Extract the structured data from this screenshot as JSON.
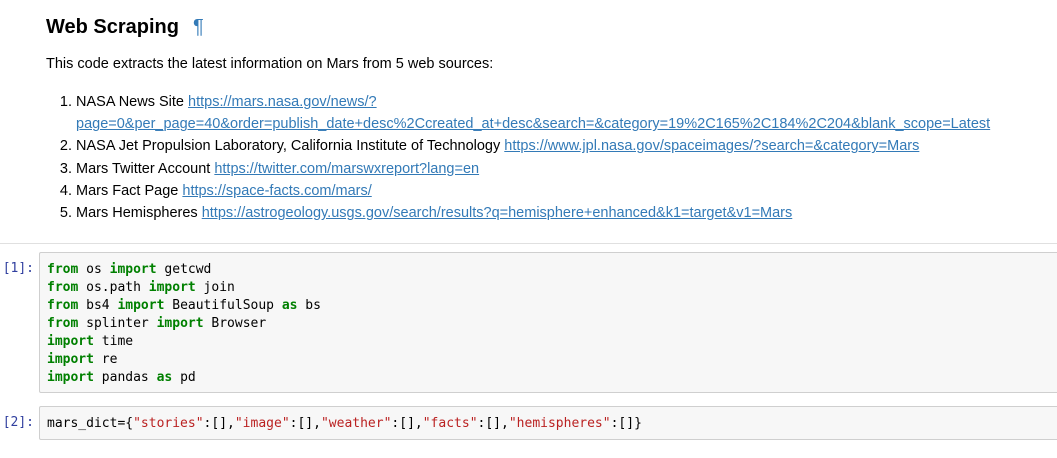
{
  "markdown": {
    "title": "Web Scraping",
    "anchor_symbol": "¶",
    "intro": "This code extracts the latest information on Mars from 5 web sources:",
    "sources": [
      {
        "label": "NASA News Site",
        "url": "https://mars.nasa.gov/news/?page=0&per_page=40&order=publish_date+desc%2Ccreated_at+desc&search=&category=19%2C165%2C184%2C204&blank_scope=Latest",
        "url_line1": "https://mars.nasa.gov/news/?",
        "url_line2": "page=0&per_page=40&order=publish_date+desc%2Ccreated_at+desc&search=&category=19%2C165%2C184%2C204&blank_scope=Latest"
      },
      {
        "label": "NASA Jet Propulsion Laboratory, California Institute of Technology",
        "url": "https://www.jpl.nasa.gov/spaceimages/?search=&category=Mars"
      },
      {
        "label": "Mars Twitter Account",
        "url": "https://twitter.com/marswxreport?lang=en"
      },
      {
        "label": "Mars Fact Page",
        "url": "https://space-facts.com/mars/"
      },
      {
        "label": "Mars Hemispheres",
        "url": "https://astrogeology.usgs.gov/search/results?q=hemisphere+enhanced&k1=target&v1=Mars"
      }
    ]
  },
  "cells": [
    {
      "prompt": "[1]:",
      "lines": [
        {
          "kw1": "from",
          "mod": " os ",
          "kw2": "import",
          "rest": " getcwd"
        },
        {
          "kw1": "from",
          "mod": " os.path ",
          "kw2": "import",
          "rest": " join"
        },
        {
          "kw1": "from",
          "mod": " bs4 ",
          "kw2": "import",
          "rest": " BeautifulSoup ",
          "kw3": "as",
          "alias": " bs"
        },
        {
          "kw1": "from",
          "mod": " splinter ",
          "kw2": "import",
          "rest": " Browser"
        },
        {
          "kw1": "import",
          "rest": " time"
        },
        {
          "kw1": "import",
          "rest": " re"
        },
        {
          "kw1": "import",
          "rest": " pandas ",
          "kw3": "as",
          "alias": " pd"
        }
      ]
    },
    {
      "prompt": "[2]:",
      "code": {
        "var": "mars_dict={",
        "k1": "\"stories\"",
        "sep1": ":[],",
        "k2": "\"image\"",
        "sep2": ":[],",
        "k3": "\"weather\"",
        "sep3": ":[],",
        "k4": "\"facts\"",
        "sep4": ":[],",
        "k5": "\"hemispheres\"",
        "end": ":[]}"
      }
    }
  ],
  "colors": {
    "link": "#337ab7",
    "prompt": "#303f9f",
    "keyword": "#008000",
    "string": "#ba2121",
    "code_bg": "#f7f7f7"
  }
}
